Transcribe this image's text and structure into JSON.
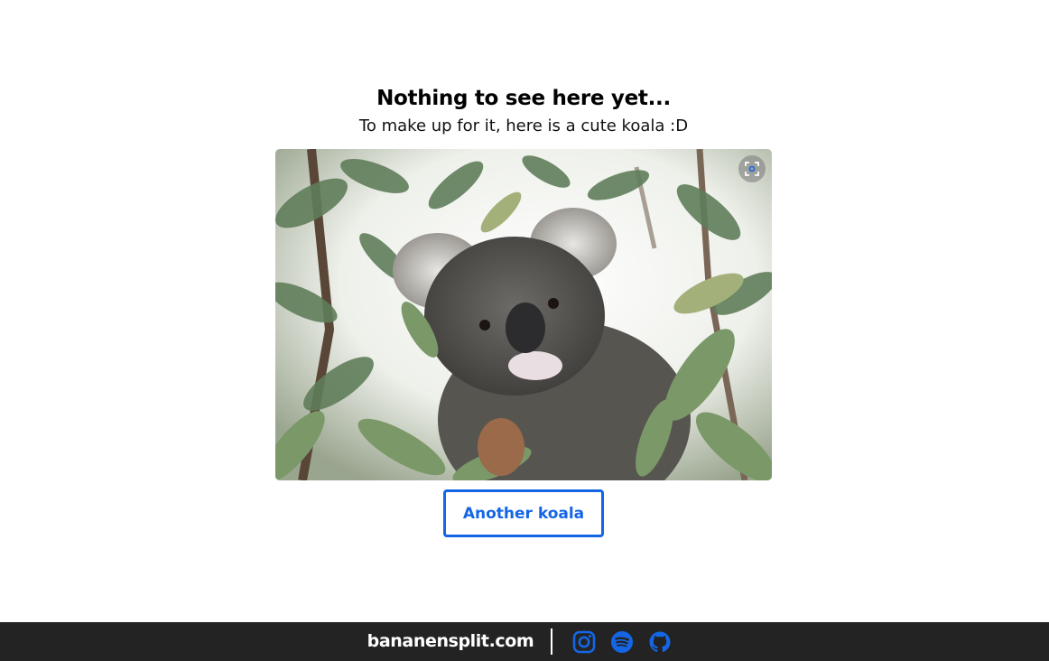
{
  "main": {
    "title": "Nothing to see here yet...",
    "subtitle": "To make up for it, here is a cute koala :D",
    "image": {
      "subject": "koala in eucalyptus tree",
      "overlay_icon": "lens-search-icon"
    },
    "button_label": "Another koala"
  },
  "footer": {
    "brand": "bananensplit.com",
    "social_links": [
      {
        "name": "instagram",
        "icon": "instagram-icon"
      },
      {
        "name": "spotify",
        "icon": "spotify-icon"
      },
      {
        "name": "github",
        "icon": "github-icon"
      }
    ]
  },
  "colors": {
    "accent": "#1466e6",
    "footer_background": "#232323",
    "page_background": "#ffffff",
    "text": "#000000"
  }
}
